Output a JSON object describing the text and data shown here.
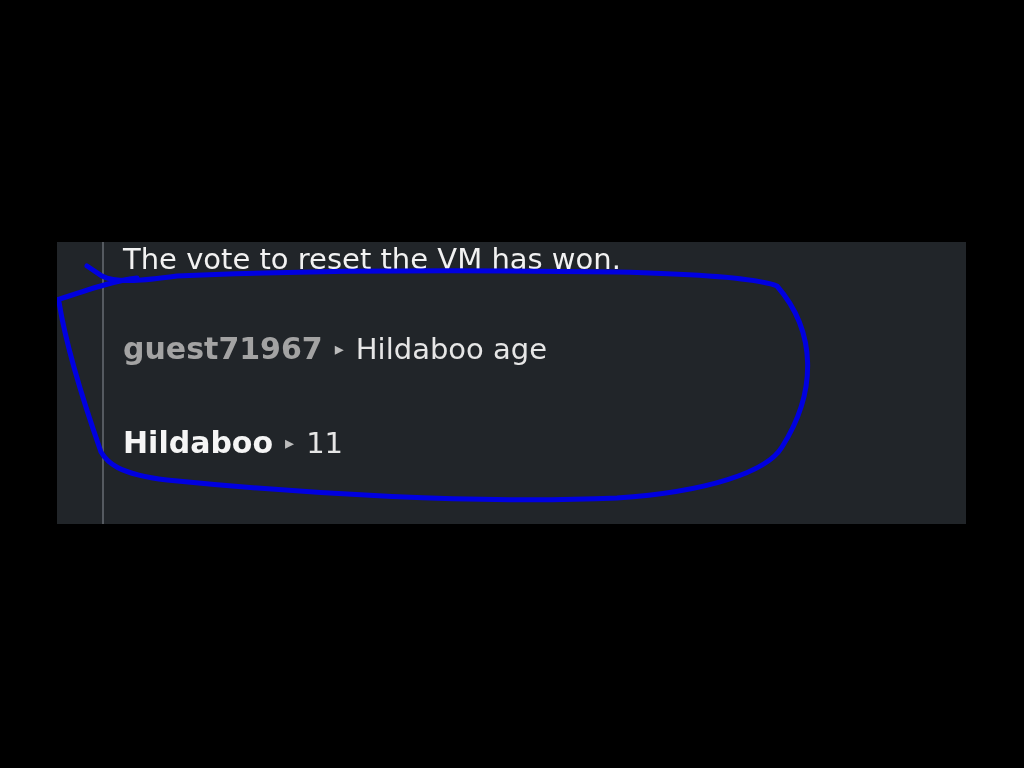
{
  "messages": [
    {
      "kind": "system",
      "text": "The vote to reset the VM has won."
    },
    {
      "kind": "chat",
      "username": "guest71967",
      "registered": false,
      "separator": "▸",
      "text": "Hildaboo age"
    },
    {
      "kind": "chat",
      "username": "Hildaboo",
      "registered": true,
      "separator": "▸",
      "text": "11"
    }
  ]
}
